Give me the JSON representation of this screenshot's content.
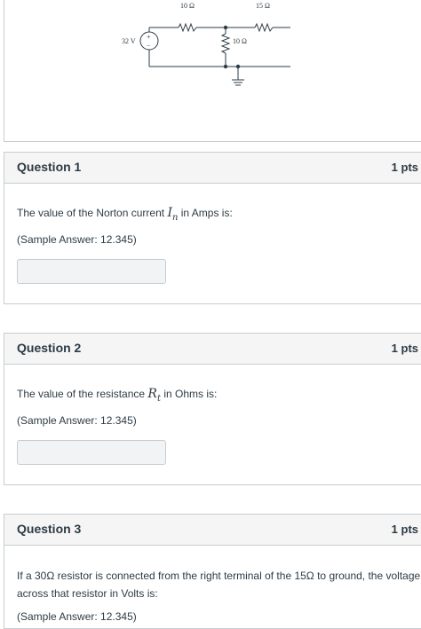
{
  "circuit": {
    "r1_label": "10 Ω",
    "r2_label": "15 Ω",
    "r3_label": "10 Ω",
    "source_label": "32 V",
    "source_plus": "+",
    "source_minus": "−"
  },
  "questions": [
    {
      "title": "Question 1",
      "points": "1 pts",
      "prompt_before": "The value of the Norton current ",
      "var_main": "I",
      "var_sub": "n",
      "prompt_after": " in Amps is:",
      "sample": "(Sample Answer: 12.345)",
      "answer_value": ""
    },
    {
      "title": "Question 2",
      "points": "1 pts",
      "prompt_before": "The value of the resistance ",
      "var_main": "R",
      "var_sub": "t",
      "prompt_after": " in Ohms is:",
      "sample": "(Sample Answer: 12.345)",
      "answer_value": ""
    },
    {
      "title": "Question 3",
      "points": "1 pts",
      "prompt_line1": "If a 30Ω resistor is connected from the right terminal of the 15Ω to ground, the voltage",
      "prompt_line2": "across that resistor in Volts is:",
      "sample": "(Sample Answer: 12.345)"
    }
  ]
}
